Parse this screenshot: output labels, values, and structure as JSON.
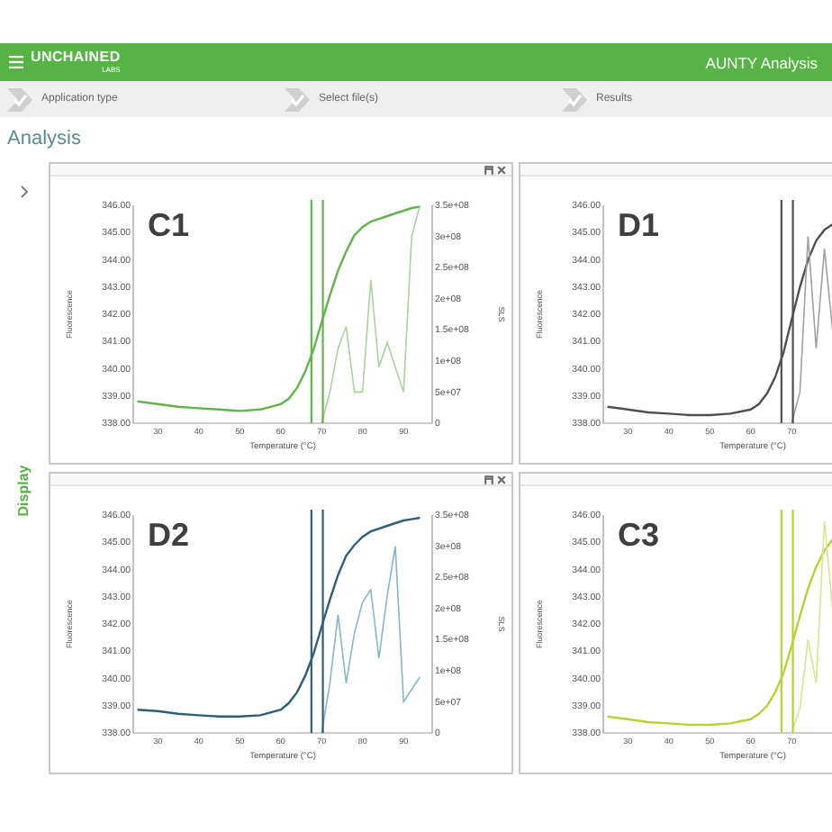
{
  "header": {
    "logo": "UNCHAINED",
    "logo_sub": "LABS",
    "title": "AUNTY Analysis"
  },
  "steps": [
    {
      "label": "Application type",
      "done": true
    },
    {
      "label": "Select file(s)",
      "done": true
    },
    {
      "label": "Results",
      "done": true
    }
  ],
  "page_title": "Analysis",
  "sidebar": {
    "label": "Display",
    "expanded": false
  },
  "panels": [
    {
      "window_buttons": true,
      "chart_data": {
        "type": "line",
        "title": "C1",
        "xlabel": "Temperature (°C)",
        "ylabel": "Fluorescence",
        "y2label": "SLS",
        "x": [
          25,
          30,
          35,
          40,
          45,
          50,
          55,
          60,
          62,
          64,
          66,
          68,
          70,
          72,
          74,
          76,
          78,
          80,
          82,
          84,
          86,
          88,
          90,
          92,
          94
        ],
        "series": [
          {
            "color": "#5fb548",
            "values": [
              338.8,
              338.7,
              338.6,
              338.55,
              338.5,
              338.45,
              338.5,
              338.7,
              338.9,
              339.3,
              339.9,
              340.7,
              341.7,
              342.7,
              343.6,
              344.3,
              344.9,
              345.2,
              345.4,
              345.5,
              345.6,
              345.7,
              345.8,
              345.9,
              345.95
            ]
          },
          {
            "color": "#a9d59a",
            "axis": "y2",
            "values": [
              null,
              null,
              null,
              null,
              null,
              null,
              null,
              null,
              null,
              null,
              null,
              null,
              0,
              50000000,
              120000000,
              155000000,
              50000000,
              50000000,
              230000000,
              90000000,
              130000000,
              90000000,
              50000000,
              300000000,
              350000000
            ]
          }
        ],
        "xlim": [
          24,
          97
        ],
        "ylim": [
          338,
          346
        ],
        "y2lim": [
          0,
          350000000
        ],
        "xticks": [
          30,
          40,
          50,
          60,
          70,
          80,
          90
        ],
        "yticks": [
          {
            "value": 338,
            "label": "338.00"
          },
          {
            "value": 339,
            "label": "339.00"
          },
          {
            "value": 340,
            "label": "340.00"
          },
          {
            "value": 341,
            "label": "341.00"
          },
          {
            "value": 342,
            "label": "342.00"
          },
          {
            "value": 343,
            "label": "343.00"
          },
          {
            "value": 344,
            "label": "344.00"
          },
          {
            "value": 345,
            "label": "345.00"
          },
          {
            "value": 346,
            "label": "346.00"
          }
        ],
        "y2ticks": [
          {
            "value": 0,
            "label": "0"
          },
          {
            "value": 50000000,
            "label": "5e+07"
          },
          {
            "value": 100000000,
            "label": "1e+08"
          },
          {
            "value": 150000000,
            "label": "1.5e+08"
          },
          {
            "value": 200000000,
            "label": "2e+08"
          },
          {
            "value": 250000000,
            "label": "2.5e+08"
          },
          {
            "value": 300000000,
            "label": "3e+08"
          },
          {
            "value": 350000000,
            "label": "3.5e+08"
          }
        ],
        "ref_lines": [
          {
            "axis": "x",
            "value": 67.5
          },
          {
            "axis": "x",
            "value": 70.3
          }
        ]
      }
    },
    {
      "window_buttons": false,
      "chart_data": {
        "type": "line",
        "title": "D1",
        "xlabel": "Temperature (°C)",
        "ylabel": "Fluorescence",
        "x": [
          25,
          30,
          35,
          40,
          45,
          50,
          55,
          60,
          62,
          64,
          66,
          68,
          70,
          72,
          74,
          76,
          78,
          80
        ],
        "series": [
          {
            "color": "#505050",
            "values": [
              338.6,
              338.5,
              338.4,
              338.35,
              338.3,
              338.3,
              338.35,
              338.5,
              338.7,
              339.1,
              339.7,
              340.6,
              341.8,
              343.0,
              344.0,
              344.7,
              345.1,
              345.3
            ]
          },
          {
            "color": "#a0a0a0",
            "axis": "y2",
            "values": [
              null,
              null,
              null,
              null,
              null,
              null,
              null,
              null,
              null,
              null,
              null,
              null,
              0,
              50000000,
              300000000,
              120000000,
              280000000,
              150000000
            ]
          }
        ],
        "xlim": [
          24,
          97
        ],
        "ylim": [
          338,
          346
        ],
        "y2lim": [
          0,
          350000000
        ],
        "xticks": [
          30,
          40,
          50,
          60,
          70
        ],
        "yticks": [
          {
            "value": 338,
            "label": "338.00"
          },
          {
            "value": 339,
            "label": "339.00"
          },
          {
            "value": 340,
            "label": "340.00"
          },
          {
            "value": 341,
            "label": "341.00"
          },
          {
            "value": 342,
            "label": "342.00"
          },
          {
            "value": 343,
            "label": "343.00"
          },
          {
            "value": 344,
            "label": "344.00"
          },
          {
            "value": 345,
            "label": "345.00"
          },
          {
            "value": 346,
            "label": "346.00"
          }
        ],
        "ref_lines": [
          {
            "axis": "x",
            "value": 67.5
          },
          {
            "axis": "x",
            "value": 70.3
          }
        ]
      }
    },
    {
      "window_buttons": true,
      "chart_data": {
        "type": "line",
        "title": "D2",
        "xlabel": "Temperature (°C)",
        "ylabel": "Fluorescence",
        "y2label": "SLS",
        "x": [
          25,
          30,
          35,
          40,
          45,
          50,
          55,
          60,
          62,
          64,
          66,
          68,
          70,
          72,
          74,
          76,
          78,
          80,
          82,
          84,
          86,
          88,
          90,
          92,
          94
        ],
        "series": [
          {
            "color": "#2d5f78",
            "values": [
              338.85,
              338.8,
              338.7,
              338.65,
              338.6,
              338.6,
              338.65,
              338.85,
              339.1,
              339.5,
              340.1,
              340.9,
              341.9,
              342.9,
              343.8,
              344.5,
              344.9,
              345.2,
              345.4,
              345.5,
              345.6,
              345.7,
              345.8,
              345.85,
              345.9
            ]
          },
          {
            "color": "#86b6cb",
            "axis": "y2",
            "values": [
              null,
              null,
              null,
              null,
              null,
              null,
              null,
              null,
              null,
              null,
              null,
              null,
              0,
              80000000,
              190000000,
              80000000,
              160000000,
              210000000,
              230000000,
              120000000,
              220000000,
              300000000,
              50000000,
              70000000,
              90000000
            ]
          }
        ],
        "xlim": [
          24,
          97
        ],
        "ylim": [
          338,
          346
        ],
        "y2lim": [
          0,
          350000000
        ],
        "xticks": [
          30,
          40,
          50,
          60,
          70,
          80,
          90
        ],
        "yticks": [
          {
            "value": 338,
            "label": "338.00"
          },
          {
            "value": 339,
            "label": "339.00"
          },
          {
            "value": 340,
            "label": "340.00"
          },
          {
            "value": 341,
            "label": "341.00"
          },
          {
            "value": 342,
            "label": "342.00"
          },
          {
            "value": 343,
            "label": "343.00"
          },
          {
            "value": 344,
            "label": "344.00"
          },
          {
            "value": 345,
            "label": "345.00"
          },
          {
            "value": 346,
            "label": "346.00"
          }
        ],
        "y2ticks": [
          {
            "value": 0,
            "label": "0"
          },
          {
            "value": 50000000,
            "label": "5e+07"
          },
          {
            "value": 100000000,
            "label": "1e+08"
          },
          {
            "value": 150000000,
            "label": "1.5e+08"
          },
          {
            "value": 200000000,
            "label": "2e+08"
          },
          {
            "value": 250000000,
            "label": "2.5e+08"
          },
          {
            "value": 300000000,
            "label": "3e+08"
          },
          {
            "value": 350000000,
            "label": "3.5e+08"
          }
        ],
        "ref_lines": [
          {
            "axis": "x",
            "value": 67.5
          },
          {
            "axis": "x",
            "value": 70.3
          }
        ]
      }
    },
    {
      "window_buttons": false,
      "chart_data": {
        "type": "line",
        "title": "C3",
        "xlabel": "Temperature (°C)",
        "ylabel": "Fluorescence",
        "x": [
          25,
          30,
          35,
          40,
          45,
          50,
          55,
          60,
          62,
          64,
          66,
          68,
          70,
          72,
          74,
          76,
          78,
          80
        ],
        "series": [
          {
            "color": "#b4d234",
            "values": [
              338.6,
              338.5,
              338.4,
              338.35,
              338.3,
              338.3,
              338.35,
              338.5,
              338.7,
              339.0,
              339.5,
              340.2,
              341.2,
              342.3,
              343.3,
              344.1,
              344.7,
              345.1
            ]
          },
          {
            "color": "#d5e78c",
            "axis": "y2",
            "values": [
              null,
              null,
              null,
              null,
              null,
              null,
              null,
              null,
              null,
              null,
              null,
              null,
              0,
              40000000,
              150000000,
              80000000,
              340000000,
              200000000
            ]
          }
        ],
        "xlim": [
          24,
          97
        ],
        "ylim": [
          338,
          346
        ],
        "y2lim": [
          0,
          350000000
        ],
        "xticks": [
          30,
          40,
          50,
          60,
          70
        ],
        "yticks": [
          {
            "value": 338,
            "label": "338.00"
          },
          {
            "value": 339,
            "label": "339.00"
          },
          {
            "value": 340,
            "label": "340.00"
          },
          {
            "value": 341,
            "label": "341.00"
          },
          {
            "value": 342,
            "label": "342.00"
          },
          {
            "value": 343,
            "label": "343.00"
          },
          {
            "value": 344,
            "label": "344.00"
          },
          {
            "value": 345,
            "label": "345.00"
          },
          {
            "value": 346,
            "label": "346.00"
          }
        ],
        "ref_lines": [
          {
            "axis": "x",
            "value": 67.5
          },
          {
            "axis": "x",
            "value": 70.3
          }
        ]
      }
    }
  ]
}
